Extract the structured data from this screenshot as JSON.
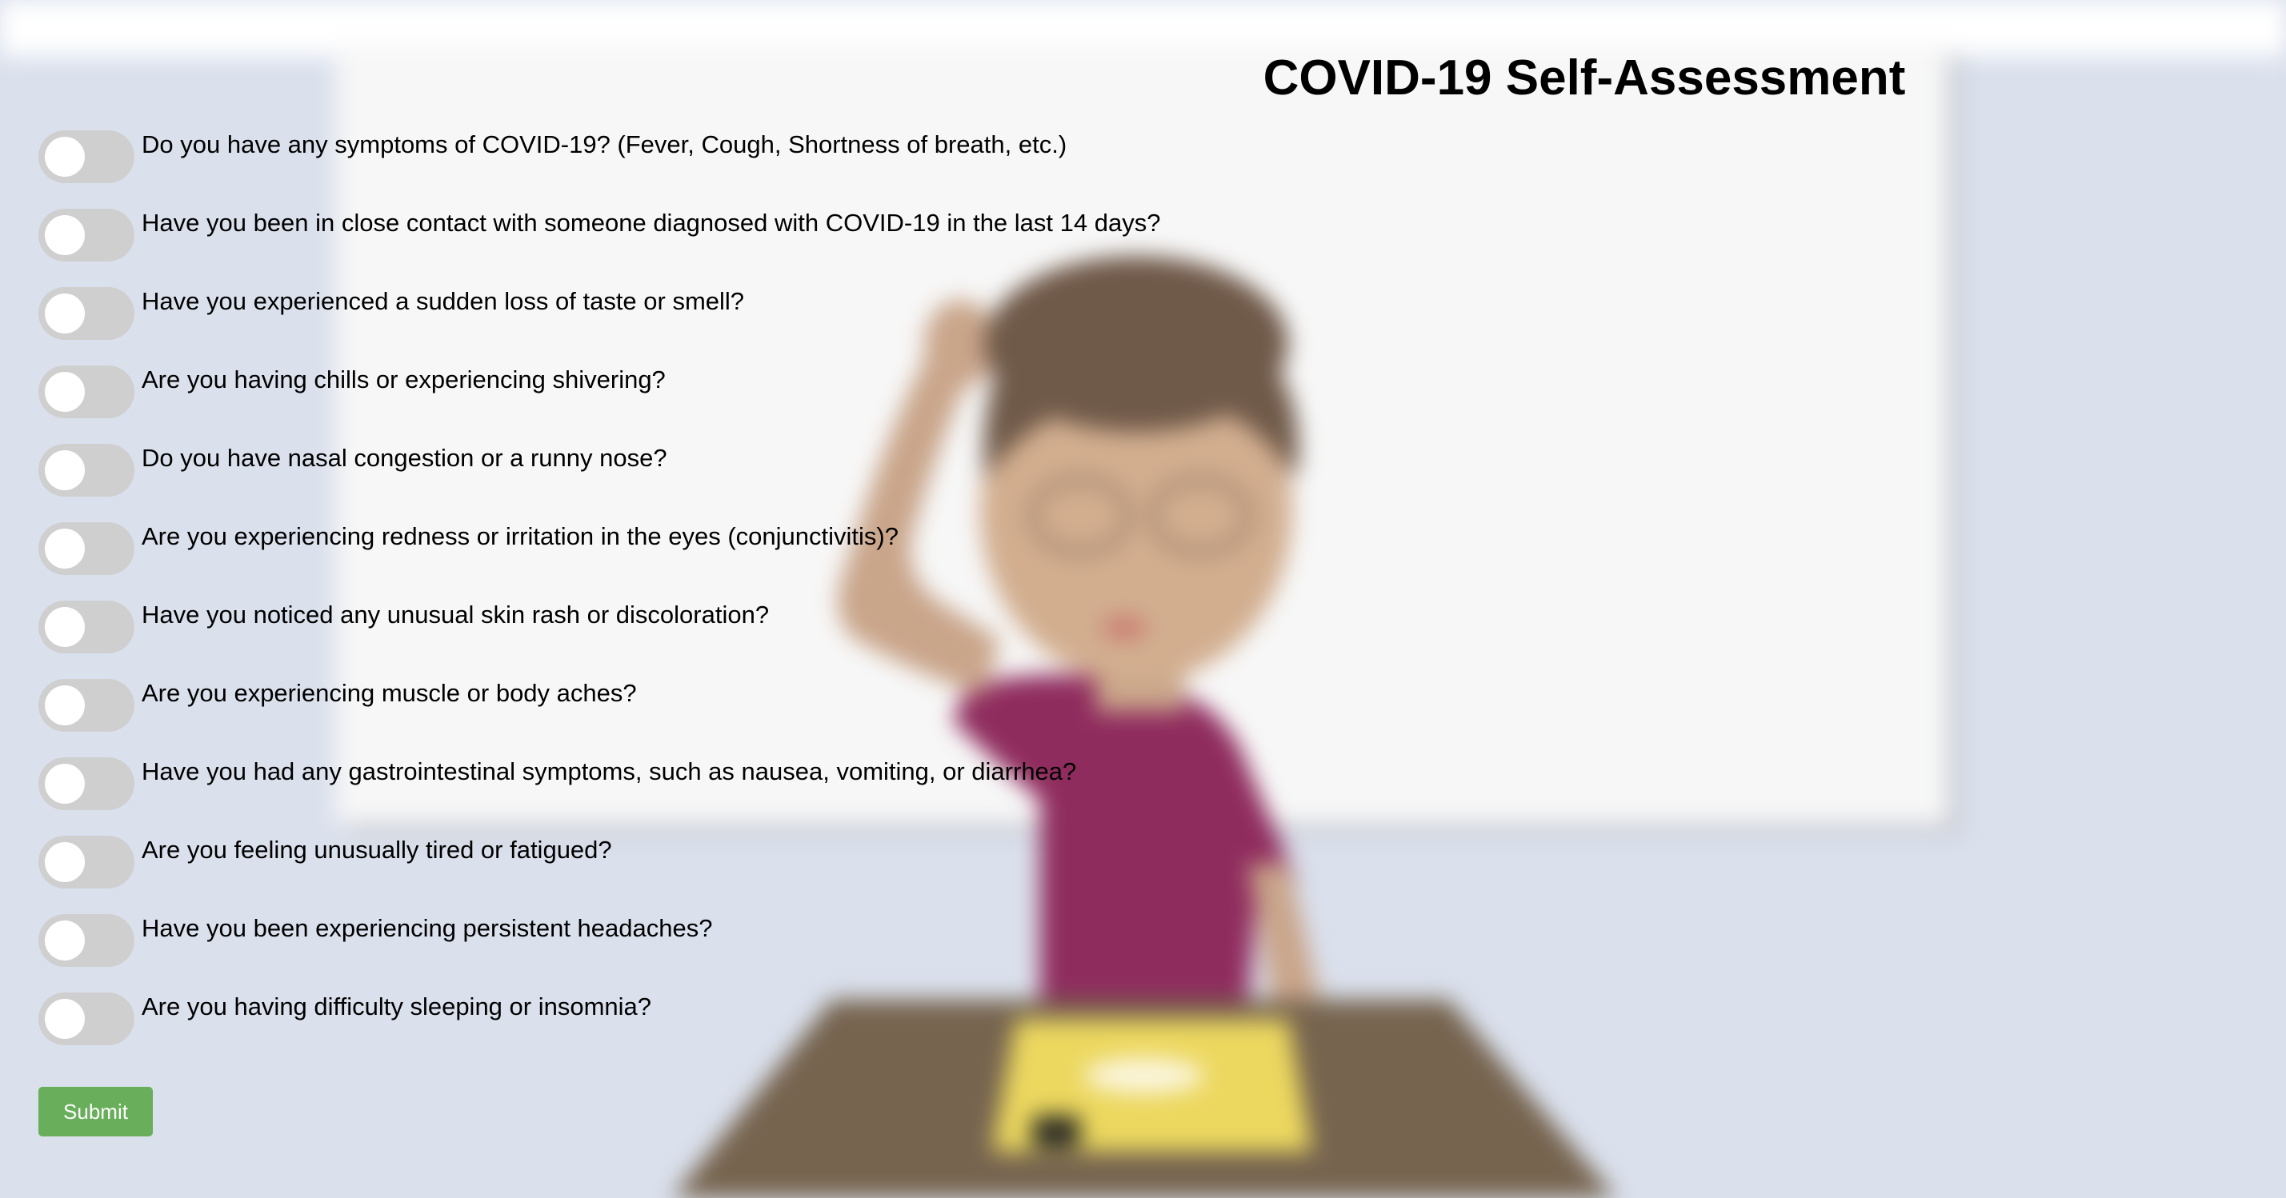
{
  "page": {
    "title": "COVID-19 Self-Assessment",
    "submit_label": "Submit"
  },
  "questions": [
    {
      "text": "Do you have any symptoms of COVID-19? (Fever, Cough, Shortness of breath, etc.)",
      "checked": false
    },
    {
      "text": "Have you been in close contact with someone diagnosed with COVID-19 in the last 14 days?",
      "checked": false
    },
    {
      "text": "Have you experienced a sudden loss of taste or smell?",
      "checked": false
    },
    {
      "text": "Are you having chills or experiencing shivering?",
      "checked": false
    },
    {
      "text": "Do you have nasal congestion or a runny nose?",
      "checked": false
    },
    {
      "text": "Are you experiencing redness or irritation in the eyes (conjunctivitis)?",
      "checked": false
    },
    {
      "text": "Have you noticed any unusual skin rash or discoloration?",
      "checked": false
    },
    {
      "text": "Are you experiencing muscle or body aches?",
      "checked": false
    },
    {
      "text": "Have you had any gastrointestinal symptoms, such as nausea, vomiting, or diarrhea?",
      "checked": false
    },
    {
      "text": "Are you feeling unusually tired or fatigued?",
      "checked": false
    },
    {
      "text": "Have you been experiencing persistent headaches?",
      "checked": false
    },
    {
      "text": "Are you having difficulty sleeping or insomnia?",
      "checked": false
    }
  ],
  "colors": {
    "background": "#dae0ec",
    "toggle_off": "#cfcfcf",
    "submit": "#69ae5a"
  }
}
